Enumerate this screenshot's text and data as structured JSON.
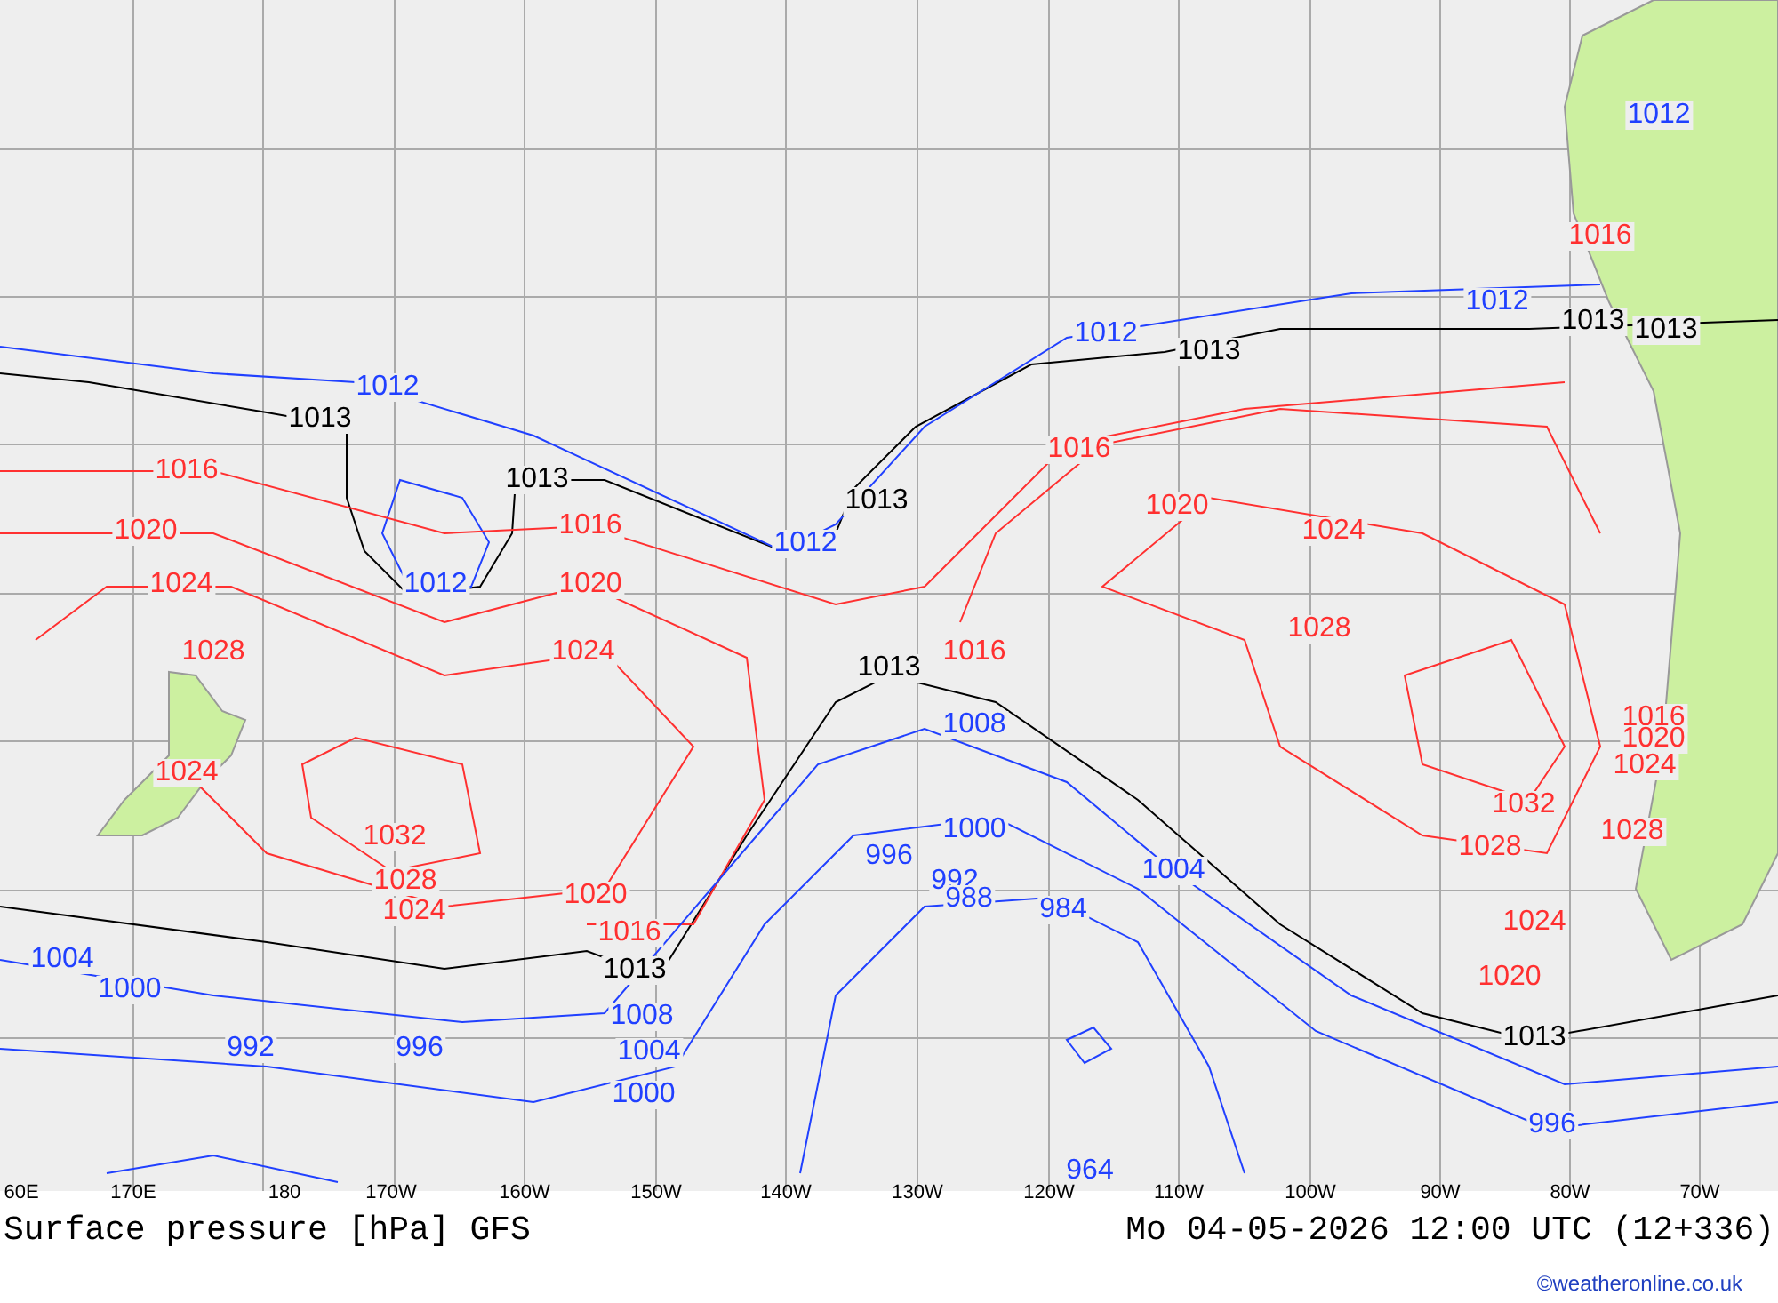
{
  "map": {
    "isobar_labels": [
      {
        "text": "1012",
        "kind": "low"
      },
      {
        "text": "1016",
        "kind": "high"
      },
      {
        "text": "1012",
        "kind": "low"
      },
      {
        "text": "1012",
        "kind": "low"
      },
      {
        "text": "1013",
        "kind": "standard"
      },
      {
        "text": "1013",
        "kind": "standard"
      },
      {
        "text": "1013",
        "kind": "standard"
      },
      {
        "text": "1012",
        "kind": "low"
      },
      {
        "text": "1013",
        "kind": "standard"
      },
      {
        "text": "1016",
        "kind": "high"
      },
      {
        "text": "1013",
        "kind": "standard"
      },
      {
        "text": "1013",
        "kind": "standard"
      },
      {
        "text": "1016",
        "kind": "high"
      },
      {
        "text": "1020",
        "kind": "high"
      },
      {
        "text": "1020",
        "kind": "high"
      },
      {
        "text": "1016",
        "kind": "high"
      },
      {
        "text": "1012",
        "kind": "low"
      },
      {
        "text": "1024",
        "kind": "high"
      },
      {
        "text": "1024",
        "kind": "high"
      },
      {
        "text": "1012",
        "kind": "low"
      },
      {
        "text": "1020",
        "kind": "high"
      },
      {
        "text": "1028",
        "kind": "high"
      },
      {
        "text": "1028",
        "kind": "high"
      },
      {
        "text": "1024",
        "kind": "high"
      },
      {
        "text": "1013",
        "kind": "standard"
      },
      {
        "text": "1016",
        "kind": "high"
      },
      {
        "text": "1008",
        "kind": "low"
      },
      {
        "text": "1016",
        "kind": "high"
      },
      {
        "text": "1020",
        "kind": "high"
      },
      {
        "text": "1024",
        "kind": "high"
      },
      {
        "text": "1024",
        "kind": "high"
      },
      {
        "text": "1032",
        "kind": "high"
      },
      {
        "text": "1032",
        "kind": "high"
      },
      {
        "text": "1000",
        "kind": "low"
      },
      {
        "text": "1028",
        "kind": "high"
      },
      {
        "text": "1028",
        "kind": "high"
      },
      {
        "text": "996",
        "kind": "low"
      },
      {
        "text": "1004",
        "kind": "low"
      },
      {
        "text": "1028",
        "kind": "high"
      },
      {
        "text": "992",
        "kind": "low"
      },
      {
        "text": "1024",
        "kind": "high"
      },
      {
        "text": "1020",
        "kind": "high"
      },
      {
        "text": "988",
        "kind": "low"
      },
      {
        "text": "984",
        "kind": "low"
      },
      {
        "text": "1024",
        "kind": "high"
      },
      {
        "text": "1016",
        "kind": "high"
      },
      {
        "text": "1004",
        "kind": "low"
      },
      {
        "text": "1013",
        "kind": "standard"
      },
      {
        "text": "1020",
        "kind": "high"
      },
      {
        "text": "1000",
        "kind": "low"
      },
      {
        "text": "1008",
        "kind": "low"
      },
      {
        "text": "1013",
        "kind": "standard"
      },
      {
        "text": "992",
        "kind": "low"
      },
      {
        "text": "996",
        "kind": "low"
      },
      {
        "text": "1004",
        "kind": "low"
      },
      {
        "text": "1000",
        "kind": "low"
      },
      {
        "text": "996",
        "kind": "low"
      },
      {
        "text": "964",
        "kind": "low"
      }
    ],
    "longitudes": [
      "60E",
      "170E",
      "180",
      "170W",
      "160W",
      "150W",
      "140W",
      "130W",
      "120W",
      "110W",
      "100W",
      "90W",
      "80W",
      "70W"
    ]
  },
  "title": "Surface pressure [hPa] GFS",
  "valid_time": "Mo 04-05-2026 12:00 UTC (12+336)",
  "copyright": "©weatheronline.co.uk"
}
